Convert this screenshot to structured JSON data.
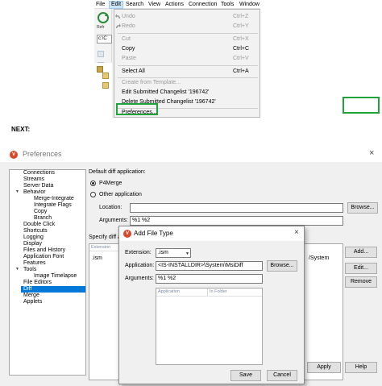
{
  "menubar": {
    "items": [
      "File",
      "Edit",
      "Search",
      "View",
      "Actions",
      "Connection",
      "Tools",
      "Window"
    ]
  },
  "toolstrip": {
    "refresh_label": "Refr",
    "drive_value": "c:\\C"
  },
  "edit_menu": {
    "items": [
      {
        "label": "Undo",
        "shortcut": "Ctrl+Z"
      },
      {
        "label": "Redo",
        "shortcut": "Ctrl+Y"
      },
      {
        "label": "Cut",
        "shortcut": "Ctrl+X"
      },
      {
        "label": "Copy",
        "shortcut": "Ctrl+C"
      },
      {
        "label": "Paste",
        "shortcut": "Ctrl+V"
      },
      {
        "label": "Select All",
        "shortcut": "Ctrl+A"
      },
      {
        "label": "Create from Template..."
      },
      {
        "label": "Edit Submitted Changelist '196742'"
      },
      {
        "label": "Delete Submitted Changelist '196742'"
      },
      {
        "label": "Preferences..."
      }
    ]
  },
  "next_label": "NEXT:",
  "preferences": {
    "title": "Preferences",
    "close": "×",
    "logo_letter": "V",
    "nav": [
      "Connections",
      "Streams",
      "Server Data",
      "Behavior",
      "Merge-Integrate",
      "Integrate Flags",
      "Copy",
      "Branch",
      "Double Click",
      "Shortcuts",
      "Logging",
      "Display",
      "Files and History",
      "Application Font",
      "Features",
      "Tools",
      "Image Timelapse",
      "File Editors",
      "Diff",
      "Merge",
      "Applets"
    ],
    "default_diff_label": "Default diff application:",
    "p4merge_label": "P4Merge",
    "other_app_label": "Other application",
    "location_label": "Location:",
    "location_value": "",
    "arguments_label": "Arguments:",
    "arguments_value": "%1 %2",
    "browse_label": "Browse...",
    "specify_label": "Specify diff a",
    "list_header": "Extension",
    "list_row_ext": ".ism",
    "list_row_path": "/System",
    "add_label": "Add...",
    "edit_label": "Edit...",
    "remove_label": "Remove",
    "apply_label": "Apply",
    "help_label": "Help"
  },
  "add_file_type": {
    "title": "Add File Type",
    "close": "×",
    "extension_label": "Extension:",
    "extension_value": ".ism",
    "application_label": "Application:",
    "application_value": "<IS-INSTALLDIR>\\System\\MsiDiff",
    "browse_label": "Browse...",
    "arguments_label": "Arguments:",
    "arguments_value": "%1 %2",
    "col_application": "Application",
    "col_in_folder": "In Folder",
    "save_label": "Save",
    "cancel_label": "Cancel"
  },
  "colors": {
    "highlight_green": "#1fa33b",
    "selection_blue": "#0078d7",
    "menu_active": "#cce4f7",
    "logo_red": "#d8482b"
  }
}
